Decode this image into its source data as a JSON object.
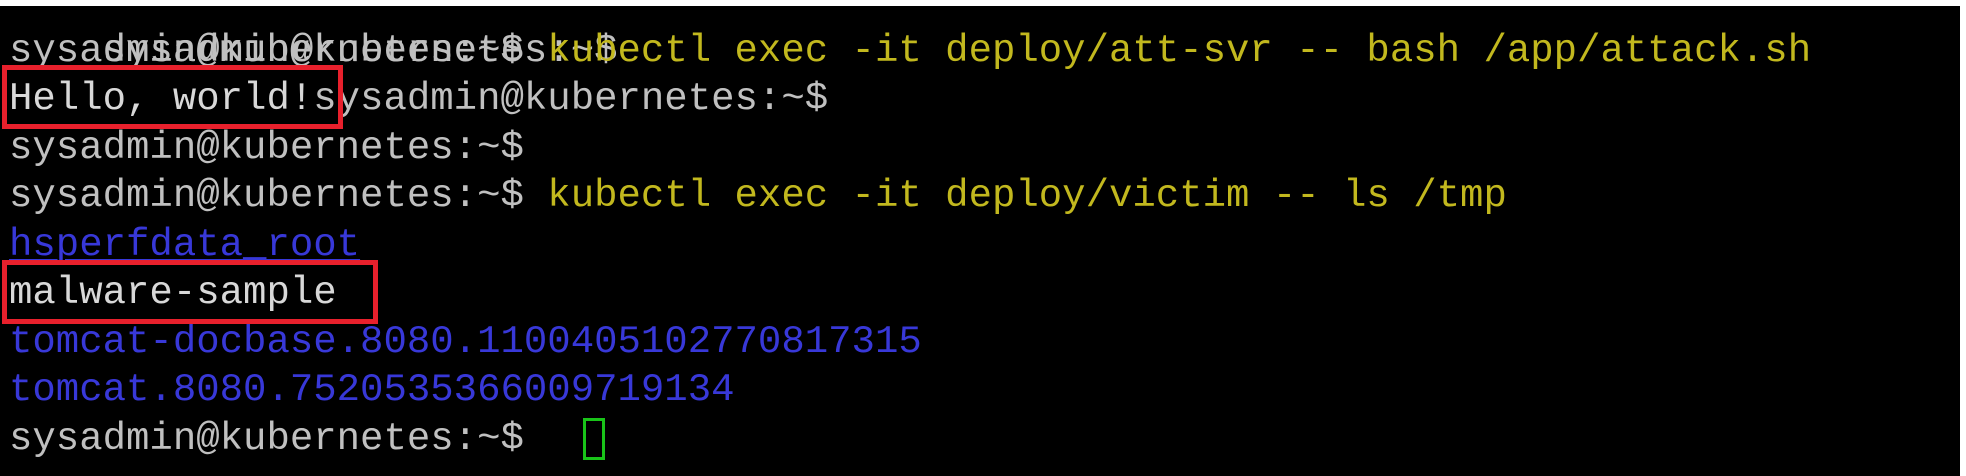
{
  "terminal": {
    "prompt": "sysadmin@kubernetes:~$",
    "partial_top_line": "sysadmin@kubernetes:~$",
    "lines": {
      "cmd_attack": "kubectl exec -it deploy/att-svr -- bash /app/attack.sh",
      "hello_output": "Hello, world!",
      "cmd_ls": "kubectl exec -it deploy/victim -- ls /tmp",
      "dir_hsperf": "hsperfdata_root",
      "file_malware": "malware-sample",
      "file_tomcat_docbase": "tomcat-docbase.8080.1100405102770817315",
      "file_tomcat": "tomcat.8080.7520535366009719134"
    },
    "colors": {
      "background": "#000000",
      "prompt_text": "#c0c0c0",
      "command_text": "#c2b81e",
      "directory_text": "#3838d8",
      "highlight_box": "#e8202c",
      "cursor": "#19c419"
    }
  }
}
